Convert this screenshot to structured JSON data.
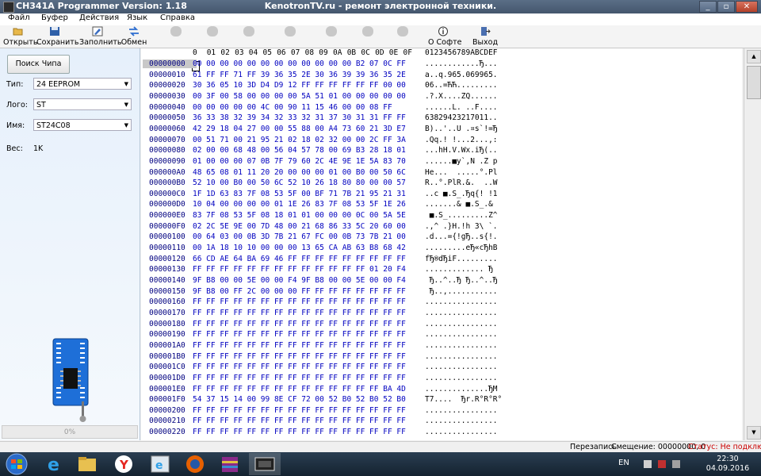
{
  "window": {
    "title": "CH341A Programmer Version: 1.18",
    "subtitle": "KenotronTV.ru - ремонт электронной техники.",
    "min": "_",
    "max": "▫",
    "close": "✕"
  },
  "menu": [
    "Файл",
    "Буфер",
    "Действия",
    "Язык",
    "Справка"
  ],
  "toolbar": {
    "open": "Открыть",
    "save": "Сохранить",
    "fill": "Заполнить",
    "swap": "Обмен",
    "about": "О Софте",
    "exit": "Выход"
  },
  "left": {
    "search_button": "Поиск Чипа",
    "type_label": "Тип:",
    "type_value": "24 EEPROM",
    "logo_label": "Лого:",
    "logo_value": "ST",
    "name_label": "Имя:",
    "name_value": "ST24C08",
    "weight_label": "Вес:",
    "weight_value": "1K",
    "progress": "0%"
  },
  "hex": {
    "header": [
      "0",
      "01",
      "02",
      "03",
      "04",
      "05",
      "06",
      "07",
      "08",
      "09",
      "0A",
      "0B",
      "0C",
      "0D",
      "0E",
      "0F"
    ],
    "ascii_header": "0123456789ABCDEF",
    "rows": [
      {
        "addr": "00000000",
        "hex": "00 00 00 00 00 00 00 00 00 00 00 00 B2 07 0C FF",
        "ascii": "............Ђ..."
      },
      {
        "addr": "00000010",
        "hex": "61 FF FF 71 FF 39 36 35 2E 30 36 39 39 36 35 2E",
        "ascii": "a..q.965.069965."
      },
      {
        "addr": "00000020",
        "hex": "30 36 05 10 3D D4 D9 12 FF FF FF FF FF FF 00 00",
        "ascii": "06..=ЋЋ........."
      },
      {
        "addr": "00000030",
        "hex": "00 3F 00 58 00 00 00 00 5A 51 01 00 00 00 00 00",
        "ascii": ".?.X....ZQ......"
      },
      {
        "addr": "00000040",
        "hex": "00 00 00 00 00 4C 00 90 11 15 46 00 00 08 FF",
        "ascii": "......L. ..F...."
      },
      {
        "addr": "00000050",
        "hex": "36 33 38 32 39 34 32 33 32 31 37 30 31 31 FF FF",
        "ascii": "63829423217011.."
      },
      {
        "addr": "00000060",
        "hex": "42 29 18 04 27 00 00 55 88 00 A4 73 60 21 3D E7",
        "ascii": "B)..'..U .¤s`!=Ђ"
      },
      {
        "addr": "00000070",
        "hex": "00 51 71 00 21 95 21 02 18 02 32 00 00 2C FF 3A",
        "ascii": ".Qq.! !...2...,:"
      },
      {
        "addr": "00000080",
        "hex": "02 00 00 68 48 00 56 04 57 78 00 69 B3 28 18 01",
        "ascii": "...hH.V.Wx.iЂ(.."
      },
      {
        "addr": "00000090",
        "hex": "01 00 00 00 07 0B 7F 79 60 2C 4E 9E 1E 5A 83 70",
        "ascii": "......■y`,N .Z p"
      },
      {
        "addr": "000000A0",
        "hex": "48 65 08 01 11 20 20 00 00 00 01 00 B0 00 50 6C",
        "ascii": "He...  .....°.Pl"
      },
      {
        "addr": "000000B0",
        "hex": "52 10 00 B0 00 50 6C 52 10 26 18 80 80 00 00 57",
        "ascii": "R..°.PlR.&.  ..W"
      },
      {
        "addr": "000000C0",
        "hex": "1F 1D 63 83 7F 08 53 5F 00 BF 71 7B 21 95 21 31",
        "ascii": "..c ■.S_.Ђq{! !1"
      },
      {
        "addr": "000000D0",
        "hex": "10 04 00 00 00 00 01 1E 26 83 7F 08 53 5F 1E 26",
        "ascii": ".......& ■.S_.&"
      },
      {
        "addr": "000000E0",
        "hex": "83 7F 08 53 5F 08 18 01 01 00 00 00 0C 00 5A 5E",
        "ascii": " ■.S_.........Z^"
      },
      {
        "addr": "000000F0",
        "hex": "02 2C 5E 9E 00 7D 48 00 21 68 86 33 5C 20 60 00",
        "ascii": ".,^ .}H.!h 3\\ `."
      },
      {
        "addr": "00000100",
        "hex": "00 64 03 00 0B 3D 7B 21 67 FC 00 0B 73 7B 21 00",
        "ascii": ".d...={!gЂ..s{!."
      },
      {
        "addr": "00000110",
        "hex": "00 1A 18 10 10 00 00 00 13 65 CA AB 63 B8 68 42",
        "ascii": ".........eЂ«cЂhB"
      },
      {
        "addr": "00000120",
        "hex": "66 CD AE 64 BA 69 46 FF FF FF FF FF FF FF FF FF",
        "ascii": "fЂ®dЂiF........."
      },
      {
        "addr": "00000130",
        "hex": "FF FF FF FF FF FF FF FF FF FF FF FF FF 01 20 F4",
        "ascii": "............. Ђ"
      },
      {
        "addr": "00000140",
        "hex": "9F B8 00 00 5E 00 00 F4 9F B8 00 00 5E 00 00 F4",
        "ascii": " Ђ..^..Ђ Ђ..^..Ђ"
      },
      {
        "addr": "00000150",
        "hex": "9F B8 00 FF 2C 00 00 00 FF FF FF FF FF FF FF FF",
        "ascii": " Ђ..,..........."
      },
      {
        "addr": "00000160",
        "hex": "FF FF FF FF FF FF FF FF FF FF FF FF FF FF FF FF",
        "ascii": "................"
      },
      {
        "addr": "00000170",
        "hex": "FF FF FF FF FF FF FF FF FF FF FF FF FF FF FF FF",
        "ascii": "................"
      },
      {
        "addr": "00000180",
        "hex": "FF FF FF FF FF FF FF FF FF FF FF FF FF FF FF FF",
        "ascii": "................"
      },
      {
        "addr": "00000190",
        "hex": "FF FF FF FF FF FF FF FF FF FF FF FF FF FF FF FF",
        "ascii": "................"
      },
      {
        "addr": "000001A0",
        "hex": "FF FF FF FF FF FF FF FF FF FF FF FF FF FF FF FF",
        "ascii": "................"
      },
      {
        "addr": "000001B0",
        "hex": "FF FF FF FF FF FF FF FF FF FF FF FF FF FF FF FF",
        "ascii": "................"
      },
      {
        "addr": "000001C0",
        "hex": "FF FF FF FF FF FF FF FF FF FF FF FF FF FF FF FF",
        "ascii": "................"
      },
      {
        "addr": "000001D0",
        "hex": "FF FF FF FF FF FF FF FF FF FF FF FF FF FF FF FF",
        "ascii": "................"
      },
      {
        "addr": "000001E0",
        "hex": "FF FF FF FF FF FF FF FF FF FF FF FF FF FF BA 4D",
        "ascii": "..............ЂM"
      },
      {
        "addr": "000001F0",
        "hex": "54 37 15 14 00 99 8E CF 72 00 52 B0 52 B0 52 B0",
        "ascii": "T7....  Ђr.R°R°R°"
      },
      {
        "addr": "00000200",
        "hex": "FF FF FF FF FF FF FF FF FF FF FF FF FF FF FF FF",
        "ascii": "................"
      },
      {
        "addr": "00000210",
        "hex": "FF FF FF FF FF FF FF FF FF FF FF FF FF FF FF FF",
        "ascii": "................"
      },
      {
        "addr": "00000220",
        "hex": "FF FF FF FF FF FF FF FF FF FF FF FF FF FF FF FF",
        "ascii": "................"
      }
    ]
  },
  "status": {
    "mode": "Перезапись",
    "offset": "Смещение: 00000000, 0",
    "state": "Статус: Не подключен"
  },
  "taskbar": {
    "lang": "EN",
    "time": "22:30",
    "date": "04.09.2016"
  },
  "colors": {
    "hex_text": "#0000c0",
    "addr_text": "#000080",
    "status_error": "#cc0000",
    "chip_board": "#1e6fd8"
  }
}
